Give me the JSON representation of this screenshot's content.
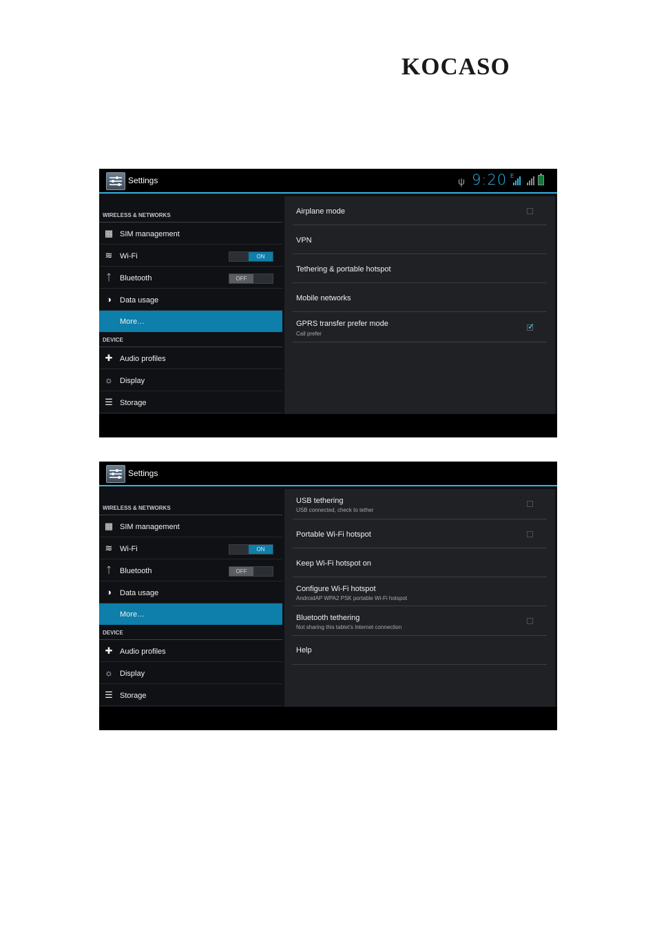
{
  "logo": "KOCASO",
  "screens": [
    {
      "title": "Settings",
      "status": {
        "clock": "9:20",
        "network_badge": "E",
        "usb_icon": "usb-icon",
        "battery": "charging"
      },
      "sidebar": {
        "cat_wireless": "WIRELESS & NETWORKS",
        "sim": "SIM management",
        "wifi": "Wi-Fi",
        "wifi_toggle": "ON",
        "bluetooth": "Bluetooth",
        "bluetooth_toggle": "OFF",
        "data_usage": "Data usage",
        "more": "More…",
        "cat_device": "DEVICE",
        "audio": "Audio profiles",
        "display": "Display",
        "storage": "Storage"
      },
      "rows": [
        {
          "title": "Airplane mode",
          "subtitle": "",
          "checkbox": "unchecked"
        },
        {
          "title": "VPN",
          "subtitle": ""
        },
        {
          "title": "Tethering & portable hotspot",
          "subtitle": ""
        },
        {
          "title": "Mobile networks",
          "subtitle": ""
        },
        {
          "title": "GPRS transfer prefer mode",
          "subtitle": "Call prefer",
          "checkbox": "checked"
        }
      ]
    },
    {
      "title": "Settings",
      "sidebar": {
        "cat_wireless": "WIRELESS & NETWORKS",
        "sim": "SIM management",
        "wifi": "Wi-Fi",
        "wifi_toggle": "ON",
        "bluetooth": "Bluetooth",
        "bluetooth_toggle": "OFF",
        "data_usage": "Data usage",
        "more": "More…",
        "cat_device": "DEVICE",
        "audio": "Audio profiles",
        "display": "Display",
        "storage": "Storage"
      },
      "rows": [
        {
          "title": "USB tethering",
          "subtitle": "USB connected, check to tether",
          "checkbox": "unchecked"
        },
        {
          "title": "Portable Wi-Fi hotspot",
          "subtitle": "",
          "checkbox": "unchecked"
        },
        {
          "title": "Keep Wi-Fi hotspot on",
          "subtitle": ""
        },
        {
          "title": "Configure Wi-Fi hotspot",
          "subtitle": "AndroidAP WPA2 PSK portable Wi-Fi hotspot"
        },
        {
          "title": "Bluetooth tethering",
          "subtitle": "Not sharing this tablet's Internet connection",
          "checkbox": "unchecked"
        },
        {
          "title": "Help",
          "subtitle": ""
        }
      ]
    }
  ],
  "colors": {
    "accent": "#33b5e5",
    "selected": "#0e7eaa",
    "panel": "#1f2125",
    "background": "#101114"
  }
}
